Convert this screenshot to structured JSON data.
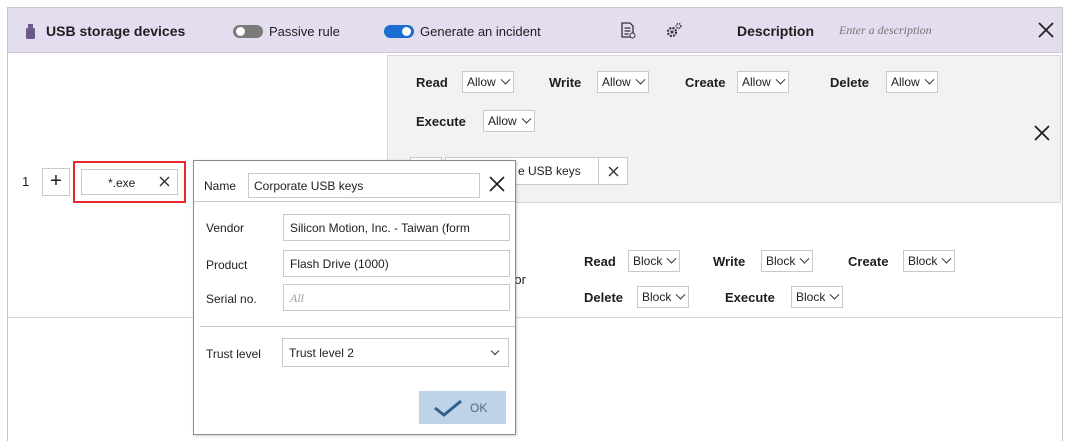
{
  "header": {
    "title": "USB storage devices",
    "passive_rule": {
      "label": "Passive rule",
      "on": false
    },
    "generate_incident": {
      "label": "Generate an incident",
      "on": true
    },
    "description_label": "Description",
    "description_placeholder": "Enter a description",
    "accent_color": "#e4dcef"
  },
  "rule": {
    "permissions_row1": [
      {
        "label": "Read",
        "value": "Allow"
      },
      {
        "label": "Write",
        "value": "Allow"
      },
      {
        "label": "Create",
        "value": "Allow"
      },
      {
        "label": "Delete",
        "value": "Allow"
      }
    ],
    "permissions_row2": [
      {
        "label": "Execute",
        "value": "Allow"
      }
    ],
    "chip_visible_text": "e USB keys"
  },
  "row": {
    "number": "1",
    "plus": "+",
    "name_value": "*.exe"
  },
  "default_behavior": {
    "label_visible": "vior",
    "row1": [
      {
        "label": "Read",
        "value": "Block"
      },
      {
        "label": "Write",
        "value": "Block"
      },
      {
        "label": "Create",
        "value": "Block"
      }
    ],
    "row2": [
      {
        "label": "Delete",
        "value": "Block"
      },
      {
        "label": "Execute",
        "value": "Block"
      }
    ]
  },
  "popup": {
    "name_label": "Name",
    "name_value": "Corporate USB keys",
    "vendor_label": "Vendor",
    "vendor_value": "Silicon Motion, Inc. - Taiwan (form",
    "product_label": "Product",
    "product_value": "Flash Drive (1000)",
    "serial_label": "Serial no.",
    "serial_placeholder": "All",
    "trust_label": "Trust level",
    "trust_value": "Trust level 2",
    "ok_label": "OK"
  },
  "colors": {
    "highlight": "#e42a2a",
    "toggle_on": "#1a6fd0",
    "ok_button": "#bed3e7"
  }
}
